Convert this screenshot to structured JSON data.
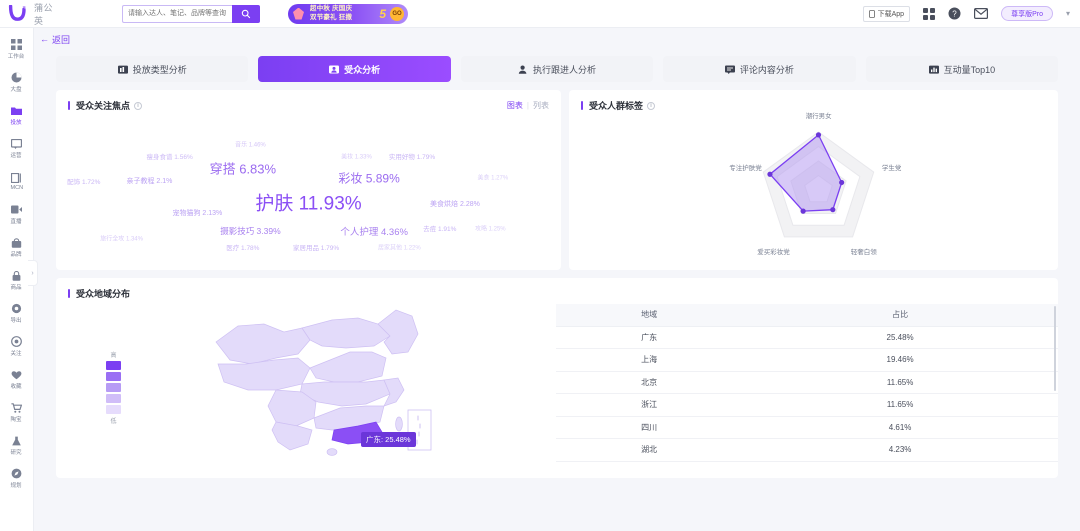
{
  "topbar": {
    "brand_mark": "蒲公英",
    "search_placeholder": "请输入达人、笔记、品牌等查询",
    "search_value": "",
    "search_icon": "search-icon",
    "banner_line1": "超中秋 庆国庆",
    "banner_line2": "双节豪礼 狂撒",
    "banner_big": "5",
    "banner_suffix": "折",
    "banner_pill": "GO",
    "download_label": "下载App",
    "apps_icon": "grid-icon",
    "help_icon": "question-icon",
    "mail_icon": "mail-icon",
    "pro_badge": "尊享版Pro",
    "caret": "▾"
  },
  "sidebar": {
    "items": [
      {
        "label": "工作台",
        "icon": "grid-icon",
        "active": false
      },
      {
        "label": "大盘",
        "icon": "pie-icon",
        "active": false
      },
      {
        "label": "投放",
        "icon": "folder-icon",
        "active": true
      },
      {
        "label": "运营",
        "icon": "message-icon",
        "active": false
      },
      {
        "label": "MCN",
        "icon": "list-icon",
        "active": false
      },
      {
        "label": "直播",
        "icon": "video-icon",
        "active": false
      },
      {
        "label": "品牌",
        "icon": "bag-icon",
        "active": false
      },
      {
        "label": "商品",
        "icon": "lock-icon",
        "active": false
      },
      {
        "label": "导出",
        "icon": "gear-icon",
        "active": false
      },
      {
        "label": "关注",
        "icon": "target-icon",
        "active": false
      },
      {
        "label": "收藏",
        "icon": "heart-icon",
        "active": false
      },
      {
        "label": "陶宝",
        "icon": "cart-icon",
        "active": false
      },
      {
        "label": "研究",
        "icon": "flask-icon",
        "active": false
      },
      {
        "label": "规划",
        "icon": "compass-icon",
        "active": false
      }
    ],
    "collapse_icon": "chevron-right-icon"
  },
  "page": {
    "back_label": "返回",
    "back_icon": "arrow-left-icon"
  },
  "tabs": [
    {
      "label": "投放类型分析",
      "icon": "chart-icon",
      "active": false
    },
    {
      "label": "受众分析",
      "icon": "person-card-icon",
      "active": true
    },
    {
      "label": "执行跟进人分析",
      "icon": "user-icon",
      "active": false
    },
    {
      "label": "评论内容分析",
      "icon": "comment-icon",
      "active": false
    },
    {
      "label": "互动量Top10",
      "icon": "bars-icon",
      "active": false
    }
  ],
  "focus_card": {
    "title": "受众关注焦点",
    "info_icon": "info-icon",
    "toggle_chart": "图表",
    "toggle_sep": "|",
    "toggle_list": "列表"
  },
  "crowd_card": {
    "title": "受众人群标签",
    "info_icon": "info-icon"
  },
  "region_card": {
    "title": "受众地域分布",
    "legend_high": "高",
    "legend_low": "低",
    "tooltip": "广东: 25.48%",
    "columns": [
      "地域",
      "占比"
    ]
  },
  "chart_data": [
    {
      "type": "wordcloud",
      "title": "受众关注焦点",
      "items": [
        {
          "label": "护肤",
          "value": 11.93,
          "text": "护肤 11.93%",
          "size": 19,
          "x": 50.0,
          "y": 60,
          "color": "#8b4ff5"
        },
        {
          "label": "穿搭",
          "value": 6.83,
          "text": "穿搭 6.83%",
          "size": 13,
          "x": 37.0,
          "y": 37,
          "color": "#9b6bf0"
        },
        {
          "label": "彩妆",
          "value": 5.89,
          "text": "彩妆 5.89%",
          "size": 12,
          "x": 62.0,
          "y": 44,
          "color": "#9b6bf0"
        },
        {
          "label": "个人护理",
          "value": 4.36,
          "text": "个人护理 4.36%",
          "size": 9.5,
          "x": 63.0,
          "y": 79,
          "color": "#a982ef"
        },
        {
          "label": "摄影技巧",
          "value": 3.39,
          "text": "摄影技巧 3.39%",
          "size": 8.5,
          "x": 38.5,
          "y": 79,
          "color": "#a982ef"
        },
        {
          "label": "美食烘焙",
          "value": 2.28,
          "text": "美食烘焙 2.28%",
          "size": 7,
          "x": 79.0,
          "y": 61,
          "color": "#bba2f3"
        },
        {
          "label": "宠物猫狗",
          "value": 2.13,
          "text": "宠物猫狗 2.13%",
          "size": 7,
          "x": 28.0,
          "y": 67,
          "color": "#bba2f3"
        },
        {
          "label": "亲子教程",
          "value": 2.1,
          "text": "亲子教程 2.1%",
          "size": 7,
          "x": 18.5,
          "y": 46,
          "color": "#bba2f3"
        },
        {
          "label": "去痘",
          "value": 1.91,
          "text": "去痘 1.91%",
          "size": 6.5,
          "x": 76.0,
          "y": 77,
          "color": "#c7b3f5"
        },
        {
          "label": "家居用品",
          "value": 1.79,
          "text": "家居用品 1.79%",
          "size": 6.5,
          "x": 51.5,
          "y": 90,
          "color": "#c9b6f5"
        },
        {
          "label": "实用好物",
          "value": 1.79,
          "text": "实用好物 1.79%",
          "size": 6.5,
          "x": 70.5,
          "y": 29,
          "color": "#c9b6f5"
        },
        {
          "label": "医疗",
          "value": 1.78,
          "text": "医疗 1.78%",
          "size": 6.5,
          "x": 37.0,
          "y": 90,
          "color": "#c9b6f5"
        },
        {
          "label": "配饰",
          "value": 1.72,
          "text": "配饰 1.72%",
          "size": 6.5,
          "x": 5.5,
          "y": 46,
          "color": "#c9b6f5"
        },
        {
          "label": "瘦身食谱",
          "value": 1.56,
          "text": "瘦身食谱 1.56%",
          "size": 6.5,
          "x": 22.5,
          "y": 29,
          "color": "#cdbbf6"
        },
        {
          "label": "音乐",
          "value": 1.46,
          "text": "音乐 1.46%",
          "size": 6,
          "x": 38.5,
          "y": 21,
          "color": "#d4c5f7"
        },
        {
          "label": "美妆",
          "value": 1.33,
          "text": "美妆 1.33%",
          "size": 6,
          "x": 59.5,
          "y": 29,
          "color": "#d8cbf8"
        },
        {
          "label": "旅行全攻",
          "value": 1.34,
          "text": "旅行全攻 1.34%",
          "size": 6,
          "x": 13.0,
          "y": 84,
          "color": "#d8cbf8"
        },
        {
          "label": "美食",
          "value": 1.27,
          "text": "美食 1.27%",
          "size": 6,
          "x": 86.5,
          "y": 43,
          "color": "#dbd0f8"
        },
        {
          "label": "攻略",
          "value": 1.25,
          "text": "攻略 1.25%",
          "size": 6,
          "x": 86.0,
          "y": 77,
          "color": "#dbd0f8"
        },
        {
          "label": "居家其他",
          "value": 1.22,
          "text": "居家其他 1.22%",
          "size": 6,
          "x": 68.0,
          "y": 90,
          "color": "#dbd0f8"
        }
      ]
    },
    {
      "type": "radar",
      "title": "受众人群标签",
      "categories": [
        "潮行男女",
        "学生党",
        "轻奢白领",
        "爱买彩妆党",
        "专注护肤党"
      ],
      "values": [
        95,
        42,
        42,
        45,
        88
      ],
      "max": 100,
      "rings": 4,
      "fill_color": "#b79cf0",
      "line_color": "#7b3ff2"
    },
    {
      "type": "map",
      "title": "受众地域分布",
      "regions": [
        {
          "name": "广东",
          "value": 25.48
        },
        {
          "name": "上海",
          "value": 19.46
        },
        {
          "name": "北京",
          "value": 11.65
        },
        {
          "name": "浙江",
          "value": 11.65
        },
        {
          "name": "四川",
          "value": 4.61
        },
        {
          "name": "湖北",
          "value": 4.23
        }
      ],
      "highlight": "广东",
      "legend": [
        "高",
        "低"
      ]
    },
    {
      "type": "table",
      "title": "受众地域分布",
      "columns": [
        "地域",
        "占比"
      ],
      "rows": [
        [
          "广东",
          "25.48%"
        ],
        [
          "上海",
          "19.46%"
        ],
        [
          "北京",
          "11.65%"
        ],
        [
          "浙江",
          "11.65%"
        ],
        [
          "四川",
          "4.61%"
        ],
        [
          "湖北",
          "4.23%"
        ]
      ]
    }
  ]
}
